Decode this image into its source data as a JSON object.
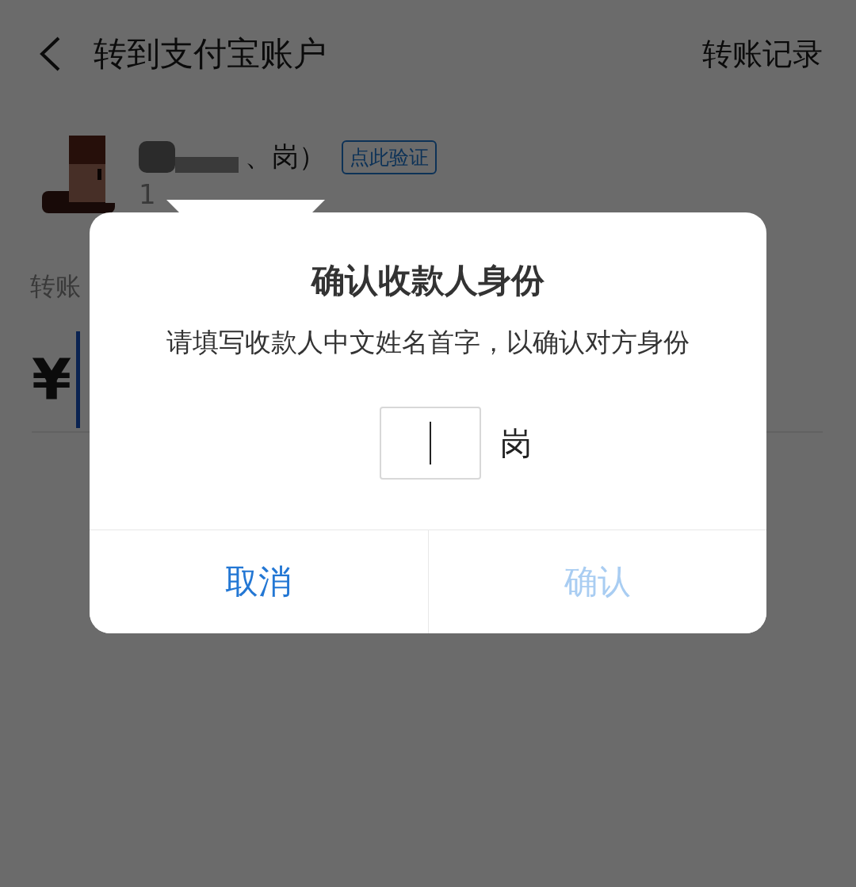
{
  "header": {
    "title": "转到支付宝账户",
    "action": "转账记录"
  },
  "recipient": {
    "name": "、岗）",
    "verify_badge": "点此验证",
    "account": "1"
  },
  "amount": {
    "label": "转账",
    "currency": "¥",
    "focused": true
  },
  "dialog": {
    "title": "确认收款人身份",
    "message": "请填写收款人中文姓名首字，以确认对方身份",
    "input_focused": true,
    "name_rest": "岗",
    "buttons": [
      {
        "label": "取消",
        "disabled": false
      },
      {
        "label": "确认",
        "disabled": true
      }
    ]
  }
}
